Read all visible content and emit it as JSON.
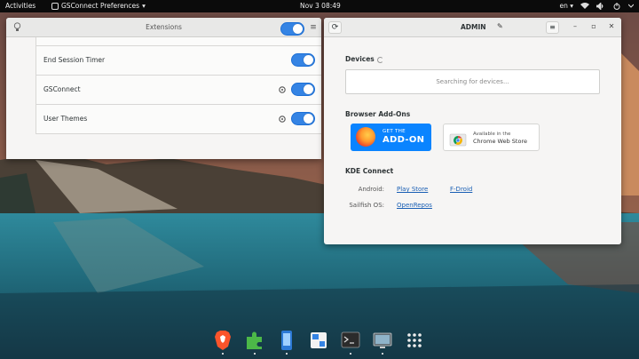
{
  "topbar": {
    "activities": "Activities",
    "app_name": "GSConnect Preferences",
    "app_caret": "▾",
    "clock": "Nov 3  08:49",
    "keyboard": "en",
    "keyboard_caret": "▾"
  },
  "extensions_window": {
    "title": "Extensions",
    "menu_glyph": "≡",
    "rows": [
      {
        "label": ""
      },
      {
        "label": "End Session Timer",
        "enabled": true,
        "has_settings": false
      },
      {
        "label": "GSConnect",
        "enabled": true,
        "has_settings": true
      },
      {
        "label": "User Themes",
        "enabled": true,
        "has_settings": true
      }
    ]
  },
  "admin_window": {
    "title": "ADMIN",
    "refresh_glyph": "⟳",
    "edit_glyph": "✎",
    "menu_glyph": "≡",
    "minimize_glyph": "–",
    "maximize_glyph": "▫",
    "close_glyph": "✕",
    "devices_label": "Devices",
    "devices_placeholder": "Searching for devices...",
    "browser_addons_label": "Browser Add-Ons",
    "firefox_badge": {
      "line1": "GET THE",
      "line2": "ADD-ON"
    },
    "chrome_badge": {
      "line1": "Available in the",
      "line2": "Chrome Web Store"
    },
    "kde_connect_label": "KDE Connect",
    "kde_rows": [
      {
        "platform": "Android:",
        "links": [
          "Play Store",
          "F-Droid"
        ]
      },
      {
        "platform": "Sailfish OS:",
        "links": [
          "OpenRepos"
        ]
      }
    ]
  },
  "dock": {
    "items": [
      {
        "icon": "brave-browser-icon",
        "running": true
      },
      {
        "icon": "extensions-puzzle-icon",
        "running": true
      },
      {
        "icon": "phone-icon",
        "running": true
      },
      {
        "icon": "settings-panel-icon",
        "running": false
      },
      {
        "icon": "terminal-icon",
        "running": true
      },
      {
        "icon": "display-icon",
        "running": true
      },
      {
        "icon": "app-grid-icon",
        "running": false
      }
    ]
  },
  "colors": {
    "accent": "#3584e4",
    "firefox_blue": "#0a84ff",
    "link": "#1a5fb4"
  }
}
